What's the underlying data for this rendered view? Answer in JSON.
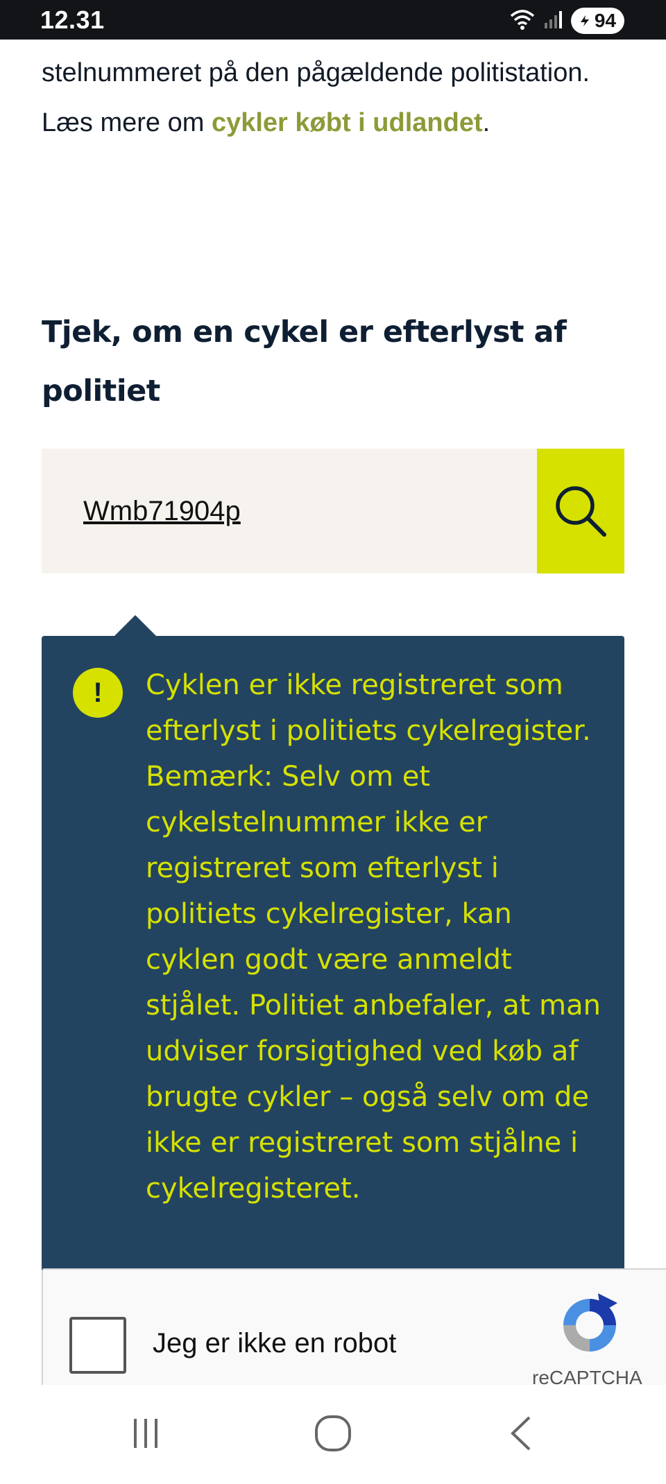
{
  "status_bar": {
    "time": "12.31",
    "battery": "94",
    "icons": [
      "wifi-icon",
      "signal-icon",
      "battery-icon"
    ]
  },
  "intro": {
    "text_before": "stelnummeret på den pågældende politistation. Læs mere om ",
    "link": "cykler købt i udlandet",
    "text_after": "."
  },
  "heading": "Tjek, om en cykel er efterlyst af politiet",
  "search": {
    "value": "Wmb71904p",
    "button_icon": "search-icon"
  },
  "result": {
    "icon": "!",
    "message": "Cyklen er ikke registreret som efterlyst i politiets cykelregister. Bemærk: Selv om et cykelstelnummer ikke er registreret som efterlyst i politiets cykelregister, kan cyklen godt være anmeldt stjålet. Politiet anbefaler, at man udviser forsigtighed ved køb af brugte cykler – også selv om de ikke er registreret som stjålne i cykelregisteret."
  },
  "recaptcha": {
    "label": "Jeg er ikke en robot",
    "brand": "reCAPTCHA"
  },
  "colors": {
    "accent": "#d6e100",
    "link": "#8e9a38",
    "callout_bg": "#234460",
    "input_bg": "#f6f3ee",
    "heading": "#0f1f33"
  }
}
